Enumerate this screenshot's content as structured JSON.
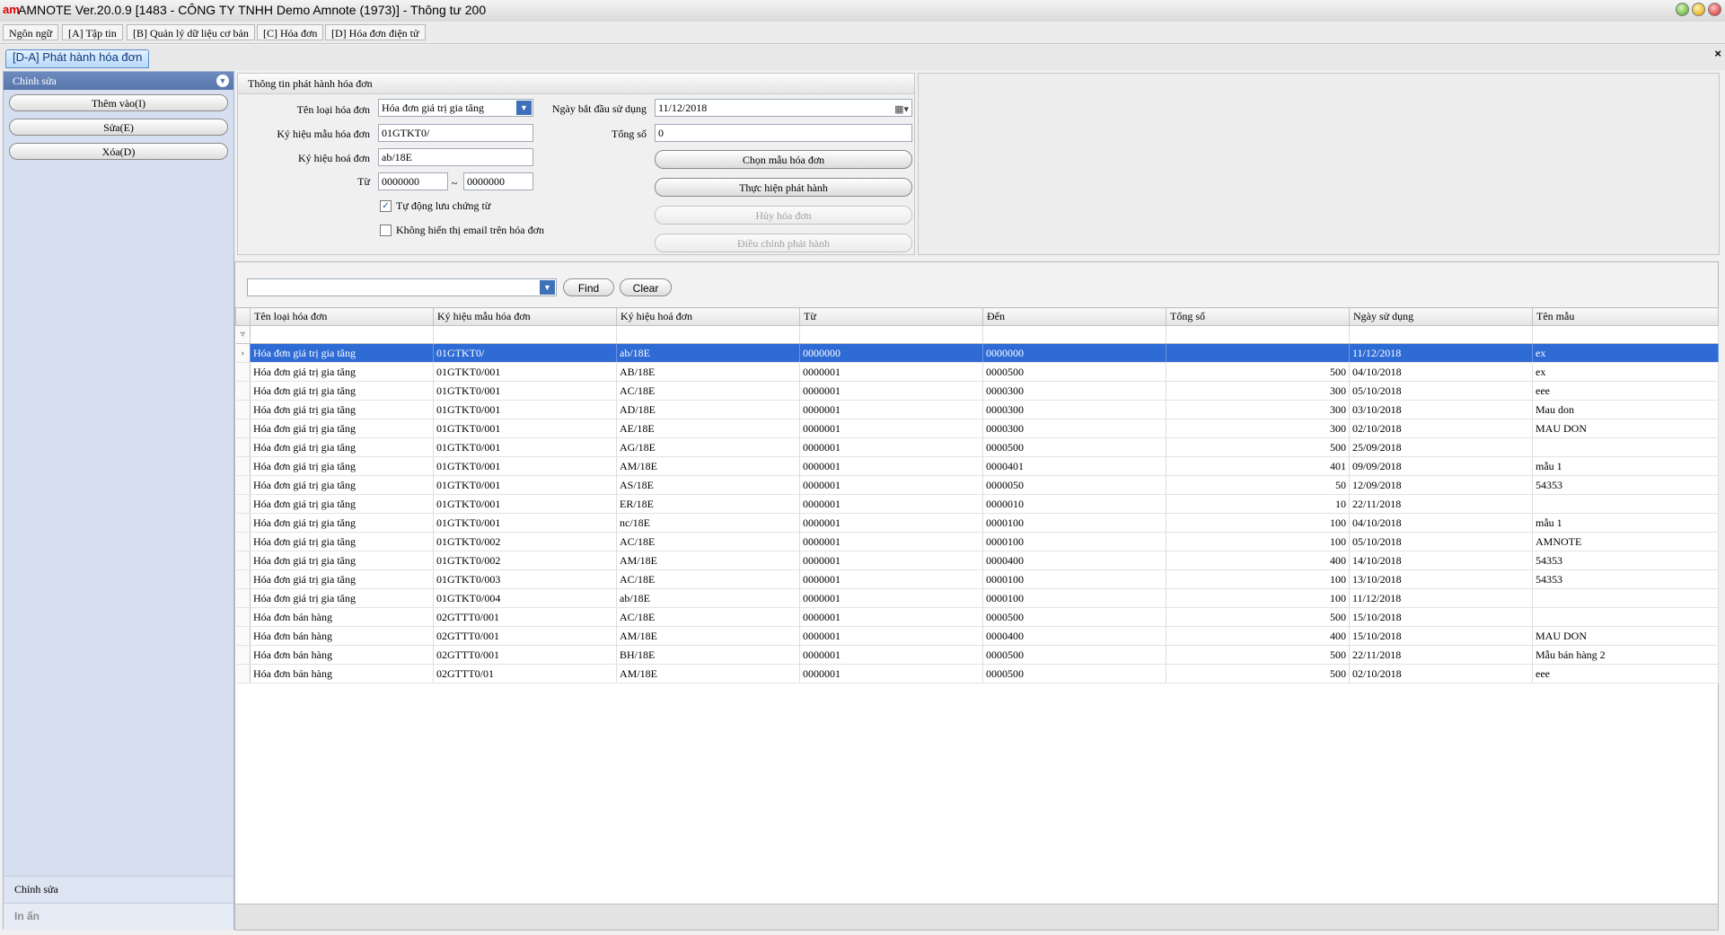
{
  "window": {
    "logo": "am",
    "title": "AMNOTE Ver.20.0.9 [1483 - CÔNG TY TNHH Demo Amnote (1973)] - Thông tư 200"
  },
  "menu": [
    "Ngôn ngữ",
    "[A] Tập tin",
    "[B] Quản lý dữ liệu cơ bản",
    "[C] Hóa đơn",
    "[D] Hóa đơn điện tử"
  ],
  "doc_tab": {
    "label": "[D-A] Phát hành hóa đơn",
    "close": "×"
  },
  "sidebar": {
    "header": "Chỉnh sửa",
    "buttons": [
      "Thêm vào(I)",
      "Sửa(E)",
      "Xóa(D)"
    ],
    "bottom_edit": "Chỉnh sửa",
    "bottom_print": "In ấn"
  },
  "form": {
    "title": "Thông tin phát hành hóa đơn",
    "invoice_type_label": "Tên loại hóa đơn",
    "invoice_type_value": "Hóa đơn giá trị gia tăng",
    "template_code_label": "Ký hiệu mẫu hóa đơn",
    "template_code_value": "01GTKT0/",
    "series_label": "Ký hiệu hoá đơn",
    "series_value": "ab/18E",
    "from_label": "Từ",
    "from_value": "0000000",
    "range_sep": "~",
    "to_value": "0000000",
    "auto_save_label": "Tự động lưu chứng từ",
    "auto_save_checked": true,
    "hide_email_label": "Không hiển thị email trên hóa đơn",
    "hide_email_checked": false,
    "start_date_label": "Ngày bắt đầu sử dụng",
    "start_date_value": "11/12/2018",
    "total_label": "Tổng số",
    "total_value": "0",
    "btn_choose_template": "Chọn mẫu hóa đơn",
    "btn_issue": "Thực hiện phát hành",
    "btn_cancel_invoice": "Hủy hóa đơn",
    "btn_adjust": "Điều chỉnh phát hành"
  },
  "find": {
    "value": "",
    "find_label": "Find",
    "clear_label": "Clear"
  },
  "grid": {
    "columns": [
      "Tên loại hóa đơn",
      "Ký hiệu mẫu hóa đơn",
      "Ký hiệu hoá đơn",
      "Từ",
      "Đến",
      "Tổng số",
      "Ngày sử dụng",
      "Tên mẫu"
    ],
    "selected_index": 0,
    "rows": [
      [
        "Hóa đơn giá trị gia tăng",
        "01GTKT0/",
        "ab/18E",
        "0000000",
        "0000000",
        "",
        "11/12/2018",
        "ex"
      ],
      [
        "Hóa đơn giá trị gia tăng",
        "01GTKT0/001",
        "AB/18E",
        "0000001",
        "0000500",
        "500",
        "04/10/2018",
        "ex"
      ],
      [
        "Hóa đơn giá trị gia tăng",
        "01GTKT0/001",
        "AC/18E",
        "0000001",
        "0000300",
        "300",
        "05/10/2018",
        "eee"
      ],
      [
        "Hóa đơn giá trị gia tăng",
        "01GTKT0/001",
        "AD/18E",
        "0000001",
        "0000300",
        "300",
        "03/10/2018",
        "Mau don"
      ],
      [
        "Hóa đơn giá trị gia tăng",
        "01GTKT0/001",
        "AE/18E",
        "0000001",
        "0000300",
        "300",
        "02/10/2018",
        "MAU DON"
      ],
      [
        "Hóa đơn giá trị gia tăng",
        "01GTKT0/001",
        "AG/18E",
        "0000001",
        "0000500",
        "500",
        "25/09/2018",
        ""
      ],
      [
        "Hóa đơn giá trị gia tăng",
        "01GTKT0/001",
        "AM/18E",
        "0000001",
        "0000401",
        "401",
        "09/09/2018",
        "mẫu 1"
      ],
      [
        "Hóa đơn giá trị gia tăng",
        "01GTKT0/001",
        "AS/18E",
        "0000001",
        "0000050",
        "50",
        "12/09/2018",
        "54353"
      ],
      [
        "Hóa đơn giá trị gia tăng",
        "01GTKT0/001",
        "ER/18E",
        "0000001",
        "0000010",
        "10",
        "22/11/2018",
        ""
      ],
      [
        "Hóa đơn giá trị gia tăng",
        "01GTKT0/001",
        "nc/18E",
        "0000001",
        "0000100",
        "100",
        "04/10/2018",
        "mẫu 1"
      ],
      [
        "Hóa đơn giá trị gia tăng",
        "01GTKT0/002",
        "AC/18E",
        "0000001",
        "0000100",
        "100",
        "05/10/2018",
        "AMNOTE"
      ],
      [
        "Hóa đơn giá trị gia tăng",
        "01GTKT0/002",
        "AM/18E",
        "0000001",
        "0000400",
        "400",
        "14/10/2018",
        "54353"
      ],
      [
        "Hóa đơn giá trị gia tăng",
        "01GTKT0/003",
        "AC/18E",
        "0000001",
        "0000100",
        "100",
        "13/10/2018",
        "54353"
      ],
      [
        "Hóa đơn giá trị gia tăng",
        "01GTKT0/004",
        "ab/18E",
        "0000001",
        "0000100",
        "100",
        "11/12/2018",
        ""
      ],
      [
        "Hóa đơn bán hàng",
        "02GTTT0/001",
        "AC/18E",
        "0000001",
        "0000500",
        "500",
        "15/10/2018",
        ""
      ],
      [
        "Hóa đơn bán hàng",
        "02GTTT0/001",
        "AM/18E",
        "0000001",
        "0000400",
        "400",
        "15/10/2018",
        "MAU DON"
      ],
      [
        "Hóa đơn bán hàng",
        "02GTTT0/001",
        "BH/18E",
        "0000001",
        "0000500",
        "500",
        "22/11/2018",
        "Mẫu bán hàng 2"
      ],
      [
        "Hóa đơn bán hàng",
        "02GTTT0/01",
        "AM/18E",
        "0000001",
        "0000500",
        "500",
        "02/10/2018",
        "eee"
      ]
    ]
  },
  "icons": {
    "combo_arrow": "chevron-down-icon",
    "calendar": "calendar-icon",
    "filter": "filter-icon",
    "row_pointer": "row-pointer-icon",
    "collapse": "collapse-icon"
  },
  "colors": {
    "selection": "#2f6bd5",
    "sidebar_header": "#5876ac",
    "combo_arrow": "#3f71b8"
  }
}
